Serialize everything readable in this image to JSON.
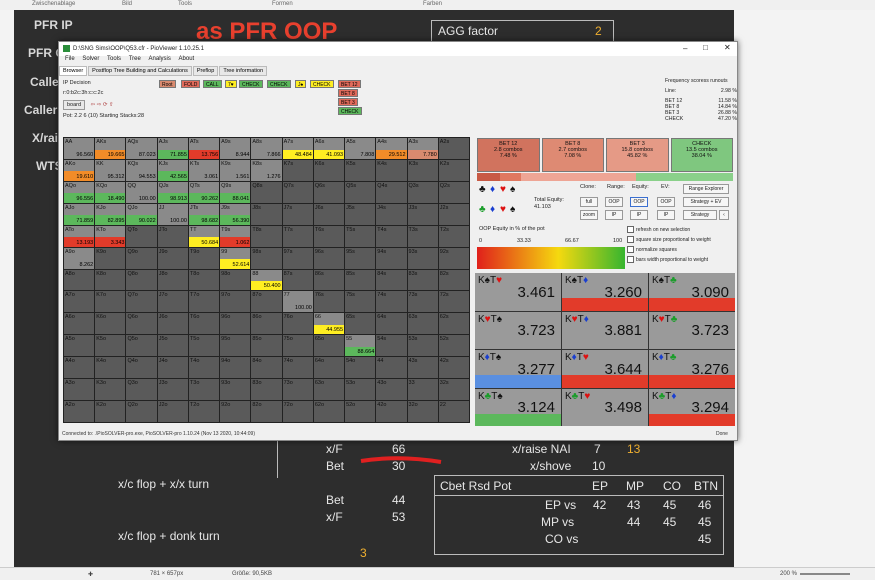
{
  "topbar": [
    "Zwischenablage",
    "Bild",
    "Tools",
    "Formen",
    "Farben"
  ],
  "slide": {
    "left_labels": [
      "PFR IP",
      "PFR O",
      "Calle",
      "Caller",
      "X/rai",
      "WTS"
    ],
    "heading": "as PFR OOP",
    "agg_label": "AGG factor",
    "agg_value": "2",
    "xf_label": "x/F",
    "xf_value": "66",
    "bet_label": "Bet",
    "bet_value": "30",
    "bet2_label": "Bet",
    "bet2_value": "44",
    "xf2_label": "x/F",
    "xf2_value": "53",
    "xr_label": "x/raise NAI",
    "xr_v1": "7",
    "xr_v2": "13",
    "xs_label": "x/shove",
    "xs_v": "10",
    "line1": "x/c flop + x/x turn",
    "line2": "x/c flop + donk turn",
    "small3": "3",
    "cbet": {
      "title": "Cbet Rsd Pot",
      "cols": [
        "EP",
        "MP",
        "CO",
        "BTN"
      ],
      "rows": [
        {
          "label": "EP vs",
          "vals": [
            "42",
            "43",
            "45",
            "46"
          ]
        },
        {
          "label": "MP vs",
          "vals": [
            "",
            "44",
            "45",
            "45"
          ]
        },
        {
          "label": "CO vs",
          "vals": [
            "",
            "",
            "",
            "45"
          ]
        }
      ]
    }
  },
  "window": {
    "title": "D:\\SNG Sims\\OOP\\Q53.cfr - PioViewer 1.10.25.1",
    "menu": [
      "File",
      "Solver",
      "Tools",
      "Tree",
      "Analysis",
      "About"
    ],
    "tabs": [
      "Browser",
      "Postflop Tree Building and Calculations",
      "Preflop",
      "Tree information"
    ],
    "info": {
      "decision": "IP Decision",
      "board_line": "r:0:b2c:3h:c:c:2c",
      "board_btn": "board",
      "pot_line": "Pot: 2.2 6 (10) Starting Stacks:28"
    },
    "nodes": [
      "Root",
      "FOLD",
      "CALL",
      "7♥",
      "CHECK",
      "CHECK",
      "J♠",
      "CHECK",
      "BET 12",
      "BET 8",
      "BET 3",
      "CHECK"
    ],
    "freq": {
      "title": "Frequency scoress runouts",
      "rows": [
        [
          "Line:",
          "2.98 %"
        ],
        [
          "BET 12",
          "11.58 %"
        ],
        [
          "BET 8",
          "14.84 %"
        ],
        [
          "BET 3",
          "26.88 %"
        ],
        [
          "CHECK",
          "47.20 %"
        ]
      ]
    },
    "stats": [
      {
        "name": "BET 12",
        "combos": "2.8 combos",
        "pct": "7.48 %"
      },
      {
        "name": "BET 8",
        "combos": "2.7 combos",
        "pct": "7.08 %"
      },
      {
        "name": "BET 3",
        "combos": "15.8 combos",
        "pct": "45.82 %"
      },
      {
        "name": "CHECK",
        "combos": "13.5 combos",
        "pct": "38.04 %"
      }
    ],
    "equity": {
      "label": "Total Equity:",
      "value": "41.103",
      "clone": "Clone:",
      "range": "Range:",
      "equity": "Equity:",
      "ev": "EV:",
      "btns": [
        "full",
        "OOP",
        "OOP",
        "OOP",
        "zoom",
        "IP",
        "IP",
        "IP"
      ],
      "explorer": "Range Explorer",
      "strategy_ev": "Strategy + EV",
      "strategy": "Strategy",
      "axis_title": "OOP Equity in % of the pot",
      "ticks": [
        "0",
        "33.33",
        "66.67",
        "100"
      ],
      "checks": [
        "refresh on new selection",
        "square size proportional to weight",
        "normalize squares",
        "bars width proportional to weight"
      ]
    },
    "combos": [
      {
        "c1": "K",
        "s1": "♠",
        "c2": "T",
        "s2": "♥",
        "v": "3.461"
      },
      {
        "c1": "K",
        "s1": "♠",
        "c2": "T",
        "s2": "♦",
        "v": "3.260"
      },
      {
        "c1": "K",
        "s1": "♠",
        "c2": "T",
        "s2": "♣",
        "v": "3.090"
      },
      {
        "c1": "K",
        "s1": "♥",
        "c2": "T",
        "s2": "♠",
        "v": "3.723"
      },
      {
        "c1": "K",
        "s1": "♥",
        "c2": "T",
        "s2": "♦",
        "v": "3.881"
      },
      {
        "c1": "K",
        "s1": "♥",
        "c2": "T",
        "s2": "♣",
        "v": "3.723"
      },
      {
        "c1": "K",
        "s1": "♦",
        "c2": "T",
        "s2": "♠",
        "v": "3.277"
      },
      {
        "c1": "K",
        "s1": "♦",
        "c2": "T",
        "s2": "♥",
        "v": "3.644"
      },
      {
        "c1": "K",
        "s1": "♦",
        "c2": "T",
        "s2": "♣",
        "v": "3.276"
      },
      {
        "c1": "K",
        "s1": "♣",
        "c2": "T",
        "s2": "♠",
        "v": "3.124"
      },
      {
        "c1": "K",
        "s1": "♣",
        "c2": "T",
        "s2": "♥",
        "v": "3.498"
      },
      {
        "c1": "K",
        "s1": "♣",
        "c2": "T",
        "s2": "♦",
        "v": "3.294"
      }
    ],
    "status": "Connected to: .\\PioSOLVER-pro.exe, PioSOLVER-pro 1.10.24 (Nov 13 2020, 10:44:09)",
    "done": "Done"
  },
  "matrix_values": {
    "AA": "96.560",
    "AKs": "19.665",
    "AQs": "87.023",
    "AJs": "71.855",
    "ATs": "13.756",
    "A9s": "8.944",
    "A8s": "7.866",
    "A7s": "48.484",
    "A6s": "41.093",
    "A5s": "7.808",
    "A4s": "29.512",
    "A3s": "7.780",
    "AKo": "19.610",
    "KK": "95.312",
    "KQs": "94.553",
    "KJs": "42.565",
    "KTs": "3.061",
    "K9s": "1.561",
    "K8s": "1.276",
    "AQo": "96.556",
    "KQo": "18.490",
    "QQ": "100.00",
    "QJs": "98.913",
    "QTs": "90.262",
    "Q9s": "88.041",
    "AJo": "71.859",
    "KJo": "82.895",
    "QJo": "90.022",
    "JJ": "100.00",
    "JTs": "98.682",
    "J9s": "56.390",
    "ATo": "13.193",
    "KTo": "3.343",
    "TT": "50.684",
    "T9s": "1.062",
    "A9o": "8.262",
    "99": "52.614",
    "88": "50.400",
    "77": "100.00",
    "66": "44.955",
    "55": "88.664"
  },
  "colors": {
    "green": "#5cb85c",
    "orange": "#f28c28",
    "yellow": "#ffee22",
    "red": "#e23b2a",
    "salmon": "#d98a6f"
  },
  "statusbar": {
    "pos": "781 × 657px",
    "size": "Größe: 90,5KB",
    "zoom": "200 %"
  }
}
